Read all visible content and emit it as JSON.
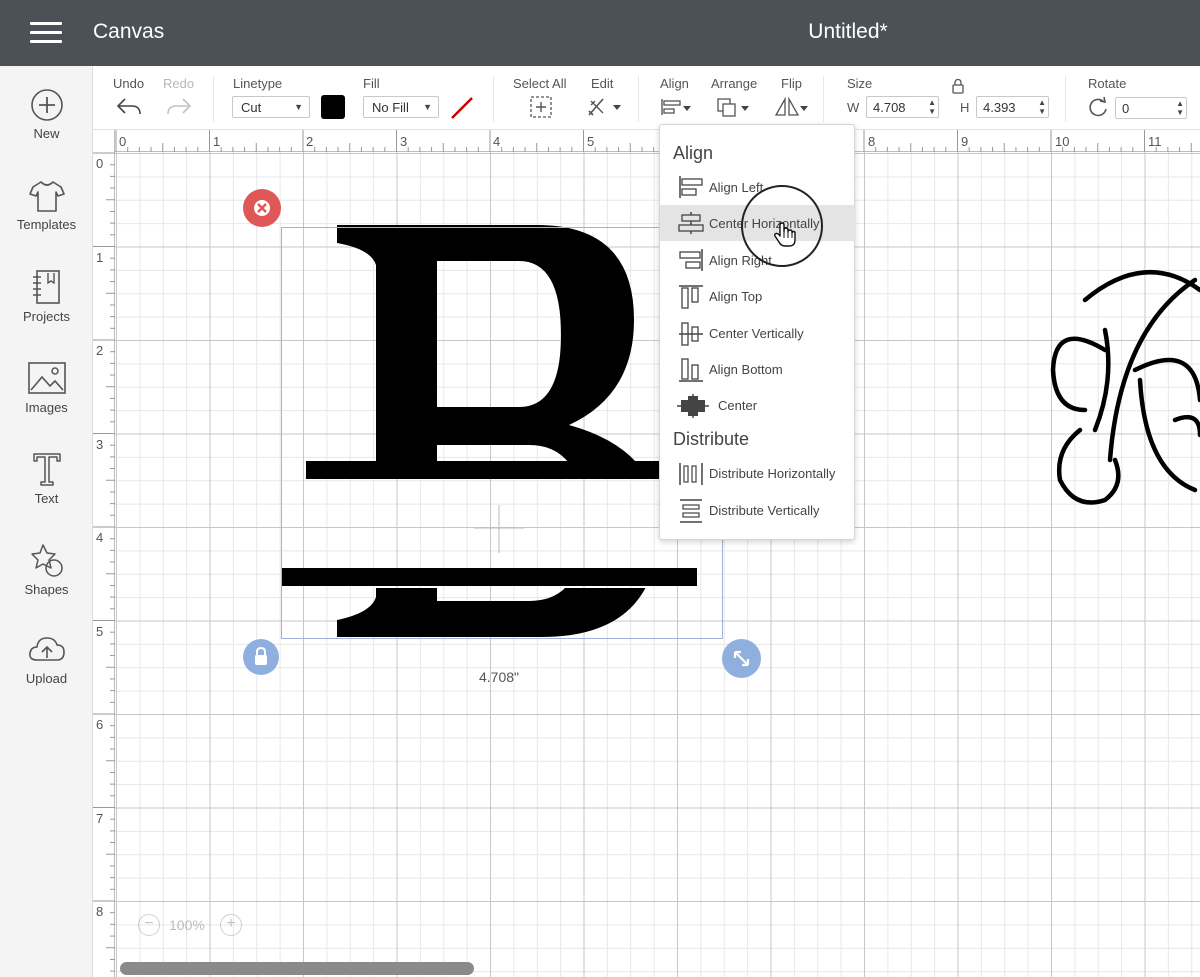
{
  "titlebar": {
    "app_title": "Canvas",
    "document_title": "Untitled*"
  },
  "sidebar": {
    "items": [
      {
        "label": "New",
        "icon": "plus-circle-icon"
      },
      {
        "label": "Templates",
        "icon": "tshirt-icon"
      },
      {
        "label": "Projects",
        "icon": "notebook-icon"
      },
      {
        "label": "Images",
        "icon": "image-icon"
      },
      {
        "label": "Text",
        "icon": "text-t-icon"
      },
      {
        "label": "Shapes",
        "icon": "shapes-icon"
      },
      {
        "label": "Upload",
        "icon": "cloud-upload-icon"
      }
    ]
  },
  "toolbar": {
    "undo_label": "Undo",
    "redo_label": "Redo",
    "linetype_label": "Linetype",
    "linetype_value": "Cut",
    "fill_label": "Fill",
    "fill_value": "No Fill",
    "select_all_label": "Select All",
    "edit_label": "Edit",
    "align_label": "Align",
    "arrange_label": "Arrange",
    "flip_label": "Flip",
    "size_label": "Size",
    "width_prefix": "W",
    "width_value": "4.708",
    "height_prefix": "H",
    "height_value": "4.393",
    "rotate_label": "Rotate",
    "rotate_value": "0",
    "linetype_color": "#000000",
    "fill_color_slash": "#cc0000"
  },
  "ruler": {
    "top": [
      "0",
      "1",
      "2",
      "3",
      "4",
      "5",
      "8",
      "9",
      "10",
      "11"
    ],
    "left": [
      "0",
      "1",
      "2",
      "3",
      "4",
      "5",
      "6",
      "7",
      "8"
    ]
  },
  "selection": {
    "width_readout": "4.708\""
  },
  "zoom": {
    "value": "100%",
    "minus": "−",
    "plus": "+"
  },
  "align_menu": {
    "align_header": "Align",
    "align_items": [
      "Align Left",
      "Center Horizontally",
      "Align Right",
      "Align Top",
      "Center Vertically",
      "Align Bottom",
      "Center"
    ],
    "highlighted": "Center Horizontally",
    "distribute_header": "Distribute",
    "distribute_items": [
      "Distribute Horizontally",
      "Distribute Vertically"
    ]
  },
  "colors": {
    "titlebar": "#4b5156",
    "delete_handle": "#e05757",
    "corner_handles": "#8fb0de",
    "selection_border": "#9db4d8"
  }
}
